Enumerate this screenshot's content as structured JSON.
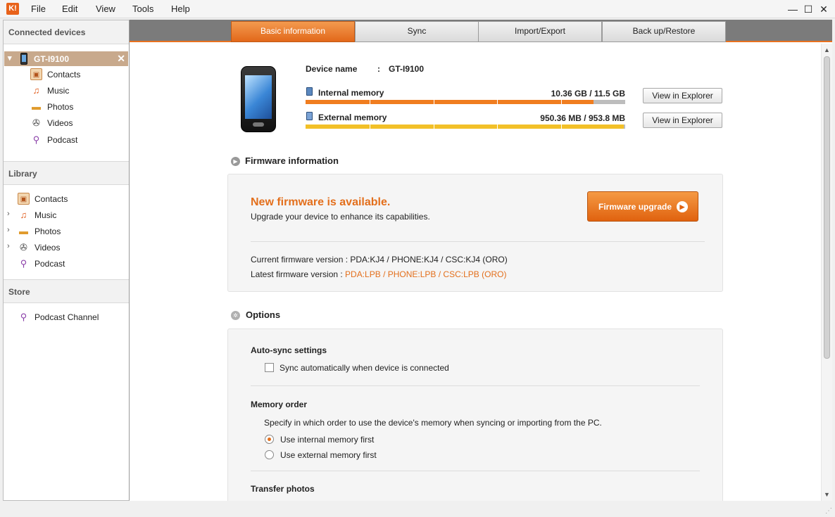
{
  "menubar": {
    "logo": "K!",
    "items": [
      "File",
      "Edit",
      "View",
      "Tools",
      "Help"
    ],
    "window_controls": {
      "minimize": "—",
      "maximize": "☐",
      "close": "✕"
    }
  },
  "sidebar": {
    "connected_title": "Connected devices",
    "device": {
      "name": "GT-I9100",
      "chevron": "⌄",
      "close": "✕"
    },
    "device_items": [
      {
        "label": "Contacts",
        "icon": "contacts-icon"
      },
      {
        "label": "Music",
        "icon": "music-icon"
      },
      {
        "label": "Photos",
        "icon": "photos-icon"
      },
      {
        "label": "Videos",
        "icon": "videos-icon"
      },
      {
        "label": "Podcast",
        "icon": "podcast-icon"
      }
    ],
    "library_title": "Library",
    "library_items": [
      {
        "label": "Contacts",
        "icon": "contacts-icon"
      },
      {
        "label": "Music",
        "icon": "music-icon"
      },
      {
        "label": "Photos",
        "icon": "photos-icon"
      },
      {
        "label": "Videos",
        "icon": "videos-icon"
      },
      {
        "label": "Podcast",
        "icon": "podcast-icon"
      }
    ],
    "store_title": "Store",
    "store_items": [
      {
        "label": "Podcast Channel",
        "icon": "podcast-icon"
      }
    ]
  },
  "tabs": [
    {
      "label": "Basic information",
      "active": true
    },
    {
      "label": "Sync",
      "active": false
    },
    {
      "label": "Import/Export",
      "active": false
    },
    {
      "label": "Back up/Restore",
      "active": false
    }
  ],
  "device_info": {
    "name_label": "Device name",
    "name_sep": ":",
    "name_value": "GT-I9100",
    "internal": {
      "label": "Internal memory",
      "usage": "10.36 GB / 11.5 GB",
      "fraction": 0.9,
      "color": "#f07d1f"
    },
    "external": {
      "label": "External memory",
      "usage": "950.36 MB / 953.8 MB",
      "fraction": 0.996,
      "color": "#f2c028"
    },
    "view_button": "View in Explorer"
  },
  "firmware": {
    "title": "Firmware information",
    "headline": "New firmware is available.",
    "subtext": "Upgrade your device to enhance its capabilities.",
    "upgrade_button": "Firmware upgrade",
    "current_label": "Current firmware version : ",
    "current_value": "PDA:KJ4 / PHONE:KJ4 / CSC:KJ4 (ORO)",
    "latest_label": "Latest firmware version : ",
    "latest_value": "PDA:LPB / PHONE:LPB / CSC:LPB (ORO)"
  },
  "options": {
    "title": "Options",
    "autosync_title": "Auto-sync settings",
    "autosync_checkbox": "Sync automatically when device is connected",
    "autosync_checked": false,
    "memory_title": "Memory order",
    "memory_desc": "Specify in which order to use the device's memory when syncing or importing from the PC.",
    "memory_internal": "Use internal memory first",
    "memory_external": "Use external memory first",
    "memory_selected": "internal",
    "transfer_title": "Transfer photos"
  },
  "colors": {
    "accent": "#e8711f",
    "selected_device": "#c8a98c"
  }
}
